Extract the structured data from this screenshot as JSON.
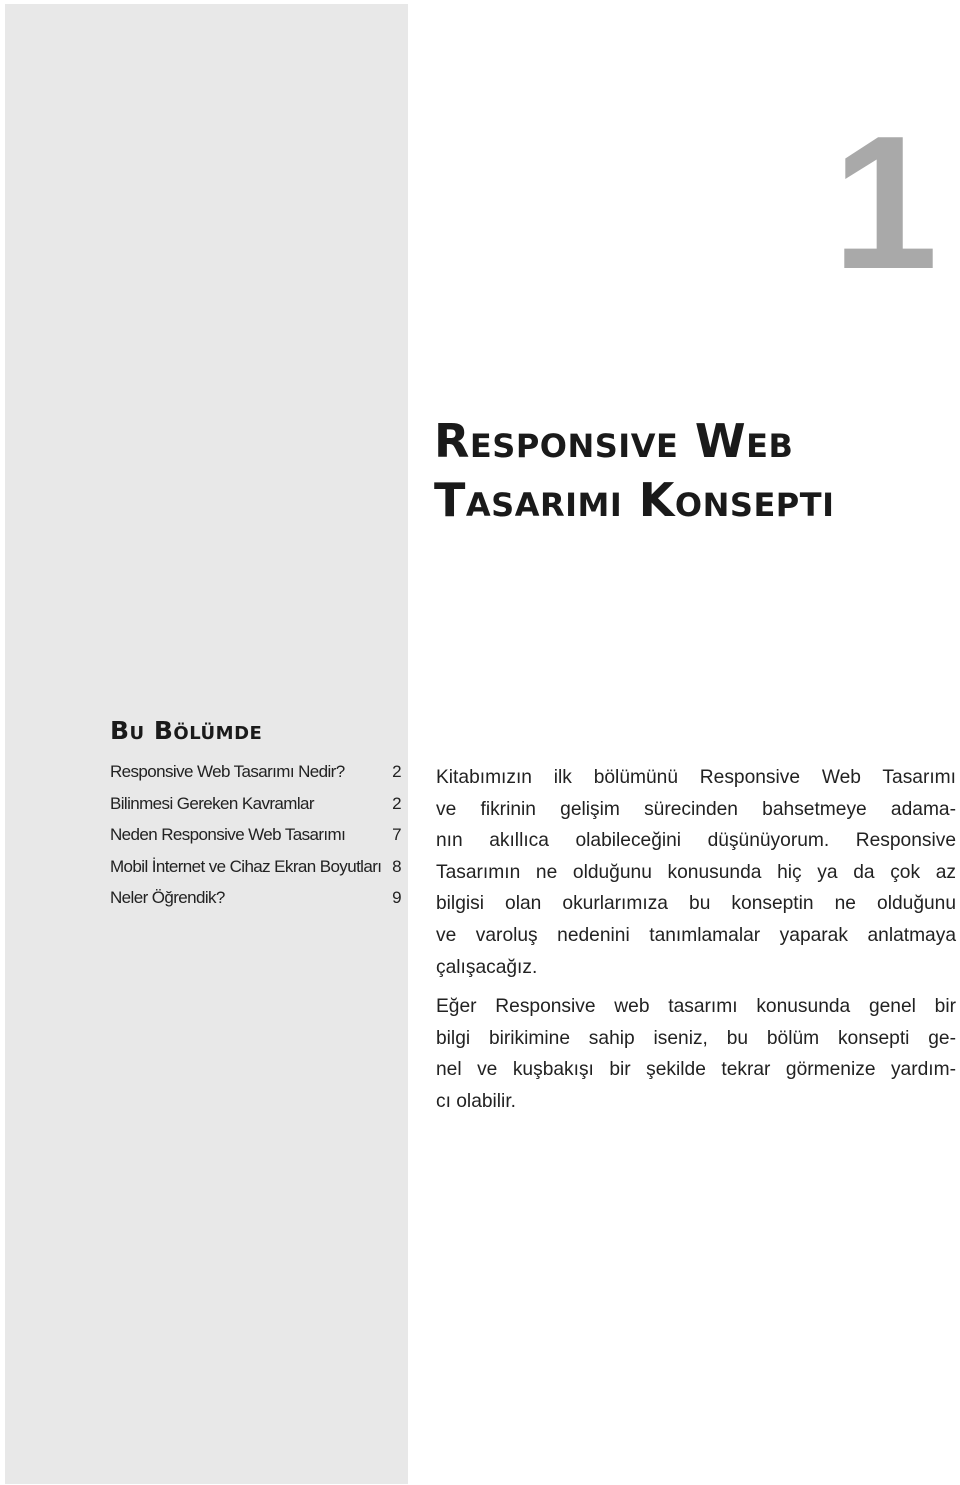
{
  "chapter": {
    "number": "1",
    "title_lines": [
      "Responsive Web",
      "Tasarımı Konsepti"
    ]
  },
  "toc": {
    "heading": "Bu Bölümde",
    "items": [
      {
        "label": "Responsive Web Tasarımı Nedir?",
        "page": "2"
      },
      {
        "label": "Bilinmesi Gereken Kavramlar",
        "page": "2"
      },
      {
        "label": "Neden Responsive Web Tasarımı",
        "page": "7"
      },
      {
        "label": "Mobil İnternet ve Cihaz Ekran Boyutları",
        "page": "8"
      },
      {
        "label": "Neler Öğrendik?",
        "page": "9"
      }
    ]
  },
  "body": {
    "paragraphs": [
      {
        "lines": [
          "Kitabımızın ilk bölümünü Responsive Web Tasarımı",
          "ve fikrinin gelişim sürecinden bahsetmeye adama-",
          "nın akıllıca olabileceğini düşünüyorum. Responsive",
          "Tasarımın ne olduğunu konusunda hiç ya da çok az",
          "bilgisi olan okurlarımıza bu konseptin ne olduğunu",
          "ve varoluş nedenini tanımlamalar yaparak anlatmaya",
          "çalışacağız."
        ]
      },
      {
        "lines": [
          "Eğer Responsive web tasarımı konusunda genel bir",
          "bilgi birikimine sahip iseniz, bu bölüm konsepti ge-",
          "nel ve kuşbakışı bir şekilde tekrar görmenize yardım-",
          "cı olabilir."
        ]
      }
    ]
  }
}
